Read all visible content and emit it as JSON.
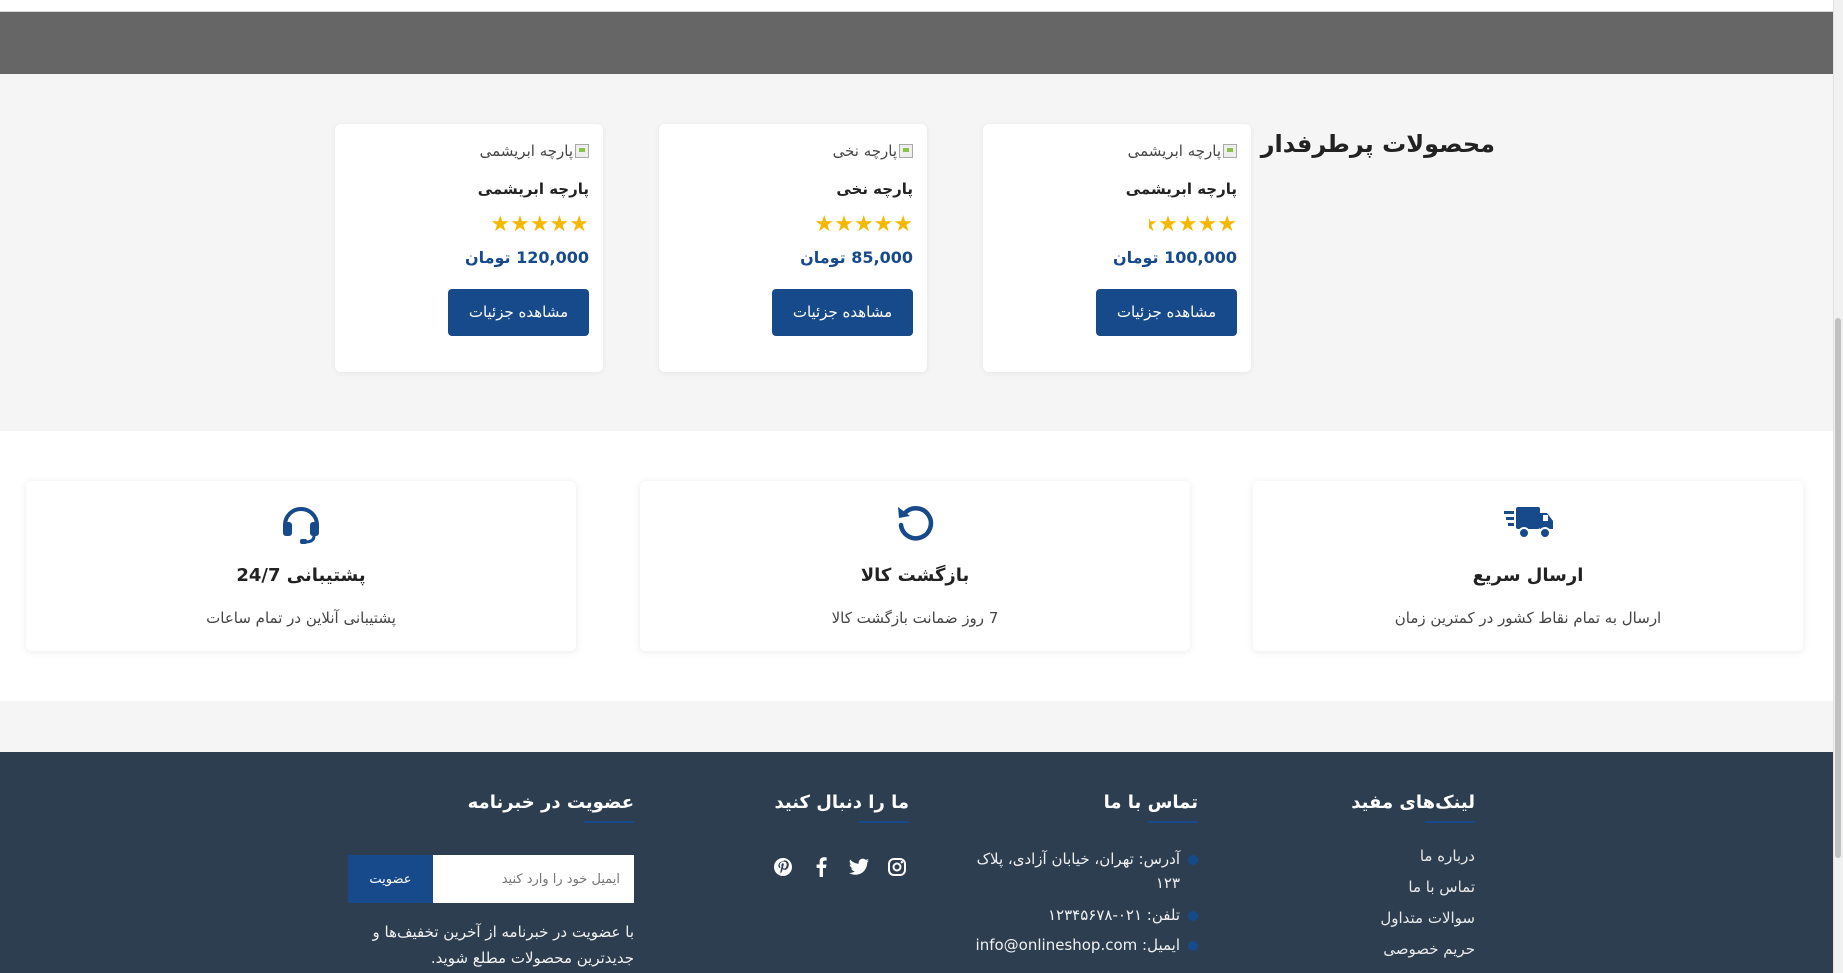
{
  "popular": {
    "title": "محصولات پرطرفدار",
    "products": [
      {
        "image_alt": "پارچه ابریشمی",
        "name": "پارچه ابریشمی",
        "stars": "★★★★",
        "rating": 4.5,
        "price": "100,000 تومان",
        "button": "مشاهده جزئیات"
      },
      {
        "image_alt": "پارچه نخی",
        "name": "پارچه نخی",
        "stars": "★★★★★",
        "rating": 5,
        "price": "85,000 تومان",
        "button": "مشاهده جزئیات"
      },
      {
        "image_alt": "پارچه ابریشمی",
        "name": "پارچه ابریشمی",
        "stars": "★★★★★",
        "rating": 5,
        "price": "120,000 تومان",
        "button": "مشاهده جزئیات"
      }
    ]
  },
  "features": [
    {
      "icon": "truck-icon",
      "title": "ارسال سریع",
      "desc": "ارسال به تمام نقاط کشور در کمترین زمان"
    },
    {
      "icon": "undo-icon",
      "title": "بازگشت کالا",
      "desc": "7 روز ضمانت بازگشت کالا"
    },
    {
      "icon": "headset-icon",
      "title": "پشتیبانی 24/7",
      "desc": "پشتیبانی آنلاین در تمام ساعات"
    }
  ],
  "footer": {
    "links": {
      "title": "لینک‌های مفید",
      "items": [
        "درباره ما",
        "تماس با ما",
        "سوالات متداول",
        "حریم خصوصی"
      ]
    },
    "contact": {
      "title": "تماس با ما",
      "address": "آدرس: تهران، خیابان آزادی، پلاک ۱۲۳",
      "phone": "تلفن: ۰۲۱-۱۲۳۴۵۶۷۸",
      "email": "ایمیل: info@onlineshop.com"
    },
    "follow": {
      "title": "ما را دنبال کنید"
    },
    "newsletter": {
      "title": "عضویت در خبرنامه",
      "placeholder": "ایمیل خود را وارد کنید",
      "button": "عضویت",
      "desc": "با عضویت در خبرنامه از آخرین تخفیف‌ها و جدیدترین محصولات مطلع شوید."
    }
  },
  "colors": {
    "primary": "#174a8b",
    "footer_bg": "#2c3e50",
    "star": "#f5b800",
    "section_bg": "#f5f5f5",
    "hero": "#666666"
  }
}
